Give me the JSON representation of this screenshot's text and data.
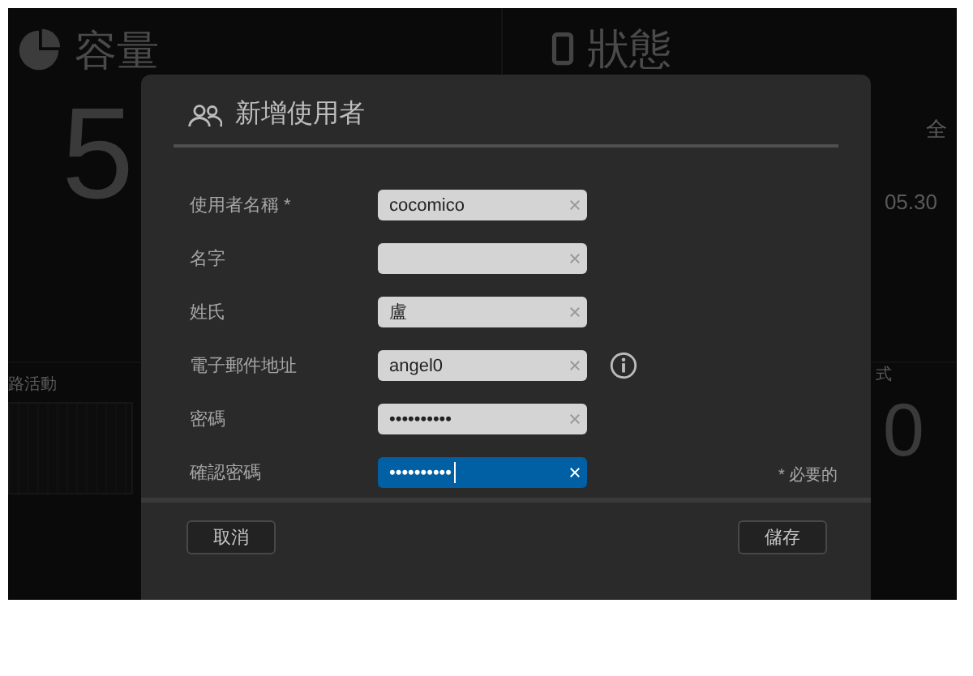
{
  "dashboard": {
    "capacity": {
      "title": "容量",
      "value": "5"
    },
    "status": {
      "title": "狀態",
      "note": "全",
      "version": "05.30"
    },
    "network": {
      "title": "路活動"
    },
    "tile_4": {
      "label": "式",
      "value": "0"
    }
  },
  "dialog": {
    "title": "新增使用者",
    "fields": [
      {
        "label": "使用者名稱 *",
        "value": "cocomico",
        "focused": false,
        "info": false
      },
      {
        "label": "名字",
        "focused": false,
        "info": false
      },
      {
        "label": "姓氏",
        "value": "盧",
        "focused": false,
        "info": false
      },
      {
        "label": "電子郵件地址",
        "value": "angel0",
        "focused": false,
        "info": true
      },
      {
        "label": "密碼",
        "value": "••••••••••",
        "focused": false,
        "info": false
      },
      {
        "label": "確認密碼",
        "value": "••••••••••",
        "focused": true,
        "info": false
      }
    ],
    "required_note": "* 必要的",
    "buttons": {
      "cancel": "取消",
      "save": "儲存"
    }
  }
}
